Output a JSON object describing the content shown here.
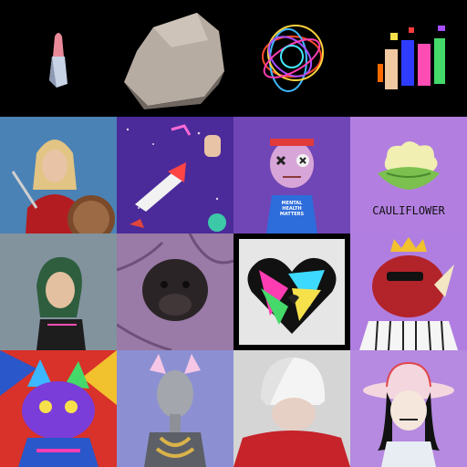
{
  "gallery": {
    "tiles": [
      {
        "name": "pink-crystal-nft",
        "bg": "#000000"
      },
      {
        "name": "grey-rock-nft",
        "bg": "#000000"
      },
      {
        "name": "neon-rings-nft",
        "bg": "#000000"
      },
      {
        "name": "glitch-figures-nft",
        "bg": "#000000"
      },
      {
        "name": "blonde-warrior-nft",
        "bg": "#4a82b5"
      },
      {
        "name": "space-collage-nft",
        "bg": "#4b2a9a"
      },
      {
        "name": "mental-health-character-nft",
        "bg": "#7046b6",
        "text": "MENTAL HEALTH MATTERS"
      },
      {
        "name": "cauliflower-nft",
        "bg": "#b27fe0",
        "text": "CAULIFLOWER"
      },
      {
        "name": "green-hair-avatar-nft",
        "bg": "#6a7e8c"
      },
      {
        "name": "monkey-head-nft",
        "bg": "#9a7aa6"
      },
      {
        "name": "rainbow-heart-nft",
        "bg": "#000000"
      },
      {
        "name": "red-rhino-king-nft",
        "bg": "#b07ee0"
      },
      {
        "name": "colorful-cat-nft",
        "bg": "#d8322a"
      },
      {
        "name": "cat-ear-woman-nft",
        "bg": "#8c90d2"
      },
      {
        "name": "white-hair-nft",
        "bg": "#d5d5d5"
      },
      {
        "name": "cowboy-girl-nft",
        "bg": "#b58ae0"
      }
    ]
  }
}
